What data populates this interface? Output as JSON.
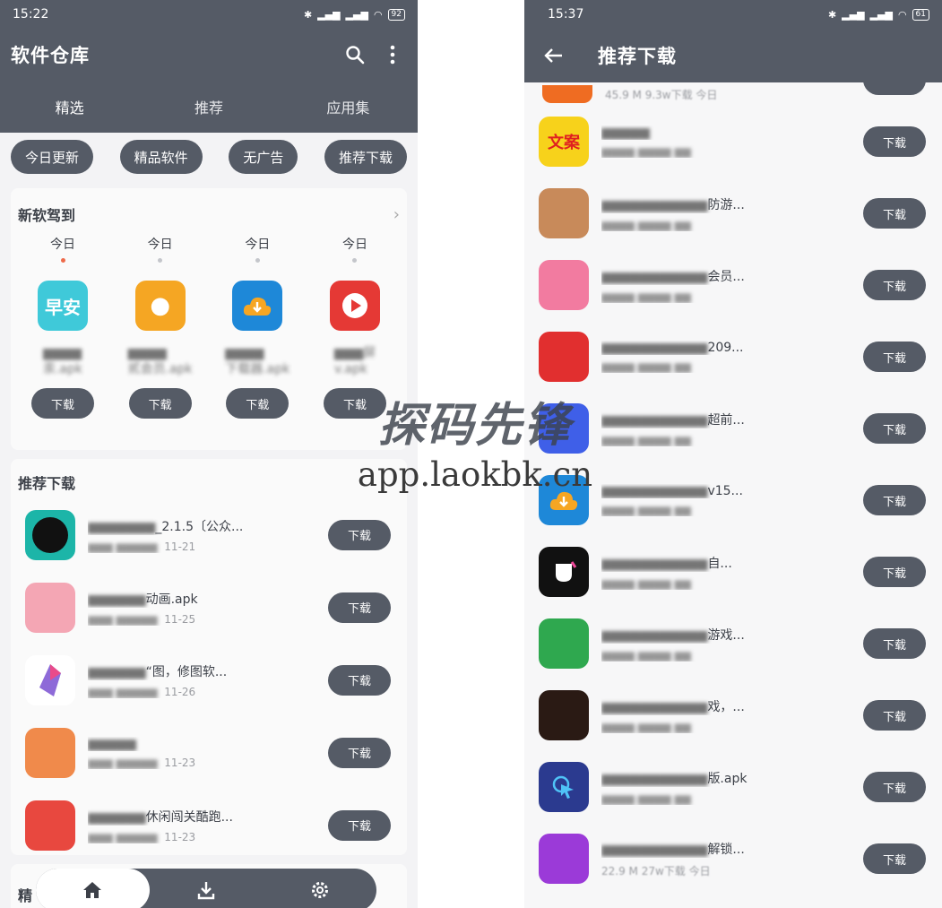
{
  "left": {
    "status": {
      "time": "15:22",
      "battery": "92"
    },
    "title": "软件仓库",
    "tabs": [
      "精选",
      "推荐",
      "应用集"
    ],
    "chips": [
      "今日更新",
      "精品软件",
      "无广告",
      "推荐下载"
    ],
    "new_section": {
      "title": "新软驾到",
      "items": [
        {
          "date": "今日",
          "name_tail": "汞.apk",
          "button": "下载",
          "icon_color": "#3fc9d9"
        },
        {
          "date": "今日",
          "name_tail": "贰会员.apk",
          "button": "下载",
          "icon_color": "#f5a623"
        },
        {
          "date": "今日",
          "name_tail": "下载器.apk",
          "button": "下载",
          "icon_color": "#1e88d8"
        },
        {
          "date": "今日",
          "name_tail": "v.apk",
          "button": "下载",
          "icon_color": "#e53935"
        }
      ]
    },
    "recommend_section": {
      "title": "推荐下载",
      "items": [
        {
          "title_visible": "_2.1.5〔公众...",
          "date": "11-21",
          "button": "下载",
          "icon_color": "#1cb5a8"
        },
        {
          "title_visible": "动画.apk",
          "date": "11-25",
          "button": "下载",
          "icon_color": "#f4a6b4"
        },
        {
          "title_visible": "“图，修图软...",
          "date": "11-26",
          "button": "下载",
          "icon_color": "#8e6ad8"
        },
        {
          "title_visible": "",
          "date": "11-23",
          "button": "下载",
          "icon_color": "#f08a4b"
        },
        {
          "title_visible": "休闲闯关酷跑...",
          "date": "11-23",
          "button": "下载",
          "icon_color": "#e8483f"
        }
      ]
    },
    "third_section_title": "精"
  },
  "right": {
    "status": {
      "time": "15:37",
      "battery": "61"
    },
    "title": "推荐下载",
    "first_row_meta": "45.9 M   9.3w下载   今日",
    "items": [
      {
        "title_visible": "",
        "icon_color": "#f7d21b",
        "icon_text": "文案",
        "button": "下载"
      },
      {
        "title_visible": "防游...",
        "icon_color": "#c88a5a",
        "icon_text": "",
        "button": "下载"
      },
      {
        "title_visible": "会员...",
        "icon_color": "#f27ba0",
        "icon_text": "",
        "button": "下载"
      },
      {
        "title_visible": "209...",
        "icon_color": "#e12f2f",
        "icon_text": "",
        "button": "下载"
      },
      {
        "title_visible": "超前...",
        "icon_color": "#3f5fe8",
        "icon_text": "",
        "button": "下载"
      },
      {
        "title_visible": "v15...",
        "icon_color": "#1e88d8",
        "icon_text": "",
        "button": "下载"
      },
      {
        "title_visible": "自...",
        "icon_color": "#111111",
        "icon_text": "",
        "button": "下载"
      },
      {
        "title_visible": "游戏...",
        "icon_color": "#2fa84f",
        "icon_text": "",
        "button": "下载"
      },
      {
        "title_visible": "戏，...",
        "icon_color": "#2a1a14",
        "icon_text": "",
        "button": "下载"
      },
      {
        "title_visible": "版.apk",
        "icon_color": "#2b3a8f",
        "icon_text": "",
        "button": "下载"
      },
      {
        "title_visible": "解锁...",
        "icon_color": "#9b3ad8",
        "icon_text": "",
        "button": "下载"
      }
    ],
    "last_row_meta": "22.9 M   27w下载   今日"
  },
  "watermark": {
    "logo": "探码先锋",
    "url": "app.laokbk.cn"
  }
}
